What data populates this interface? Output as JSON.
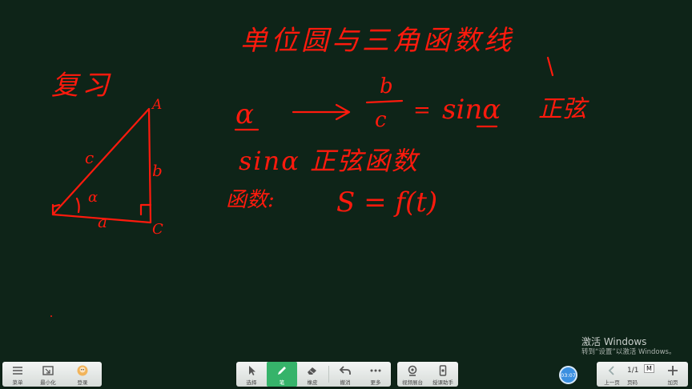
{
  "board": {
    "title": "单位圆与三角函数线",
    "review": "复习",
    "triangle": {
      "vertex_a": "A",
      "vertex_c": "C",
      "side_a": "a",
      "side_b": "b",
      "side_c": "c",
      "angle": "α"
    },
    "line1": {
      "alpha": "α",
      "frac_num": "b",
      "frac_den": "c",
      "equals": "=",
      "sin": "sinα",
      "name": "正弦"
    },
    "line2": {
      "text": "sinα 正弦函数"
    },
    "line3": {
      "label": "函数:",
      "formula": "S = f(t)"
    }
  },
  "watermark": {
    "line1": "激活 Windows",
    "line2": "转到“设置”以激活 Windows。"
  },
  "toolbar_left": {
    "menu_label": "菜单",
    "minimize_label": "最小化",
    "login_label": "登录"
  },
  "toolbar_center": {
    "select_label": "选择",
    "pen_label": "笔",
    "eraser_label": "橡皮",
    "undo_label": "撤消",
    "more_label": "更多"
  },
  "toolbar_right": {
    "video_label": "视频展台",
    "mobile_label": "授课助手"
  },
  "clock": {
    "time": "03:07"
  },
  "pager": {
    "prev_label": "上一页",
    "page_label": "页码",
    "page_value": "1/1",
    "badge": "M",
    "add_label": "加页"
  },
  "colors": {
    "board": "#0e2418",
    "ink": "#ff1a0d",
    "pen_active": "#36b36a",
    "clock": "#3a8fe0"
  }
}
